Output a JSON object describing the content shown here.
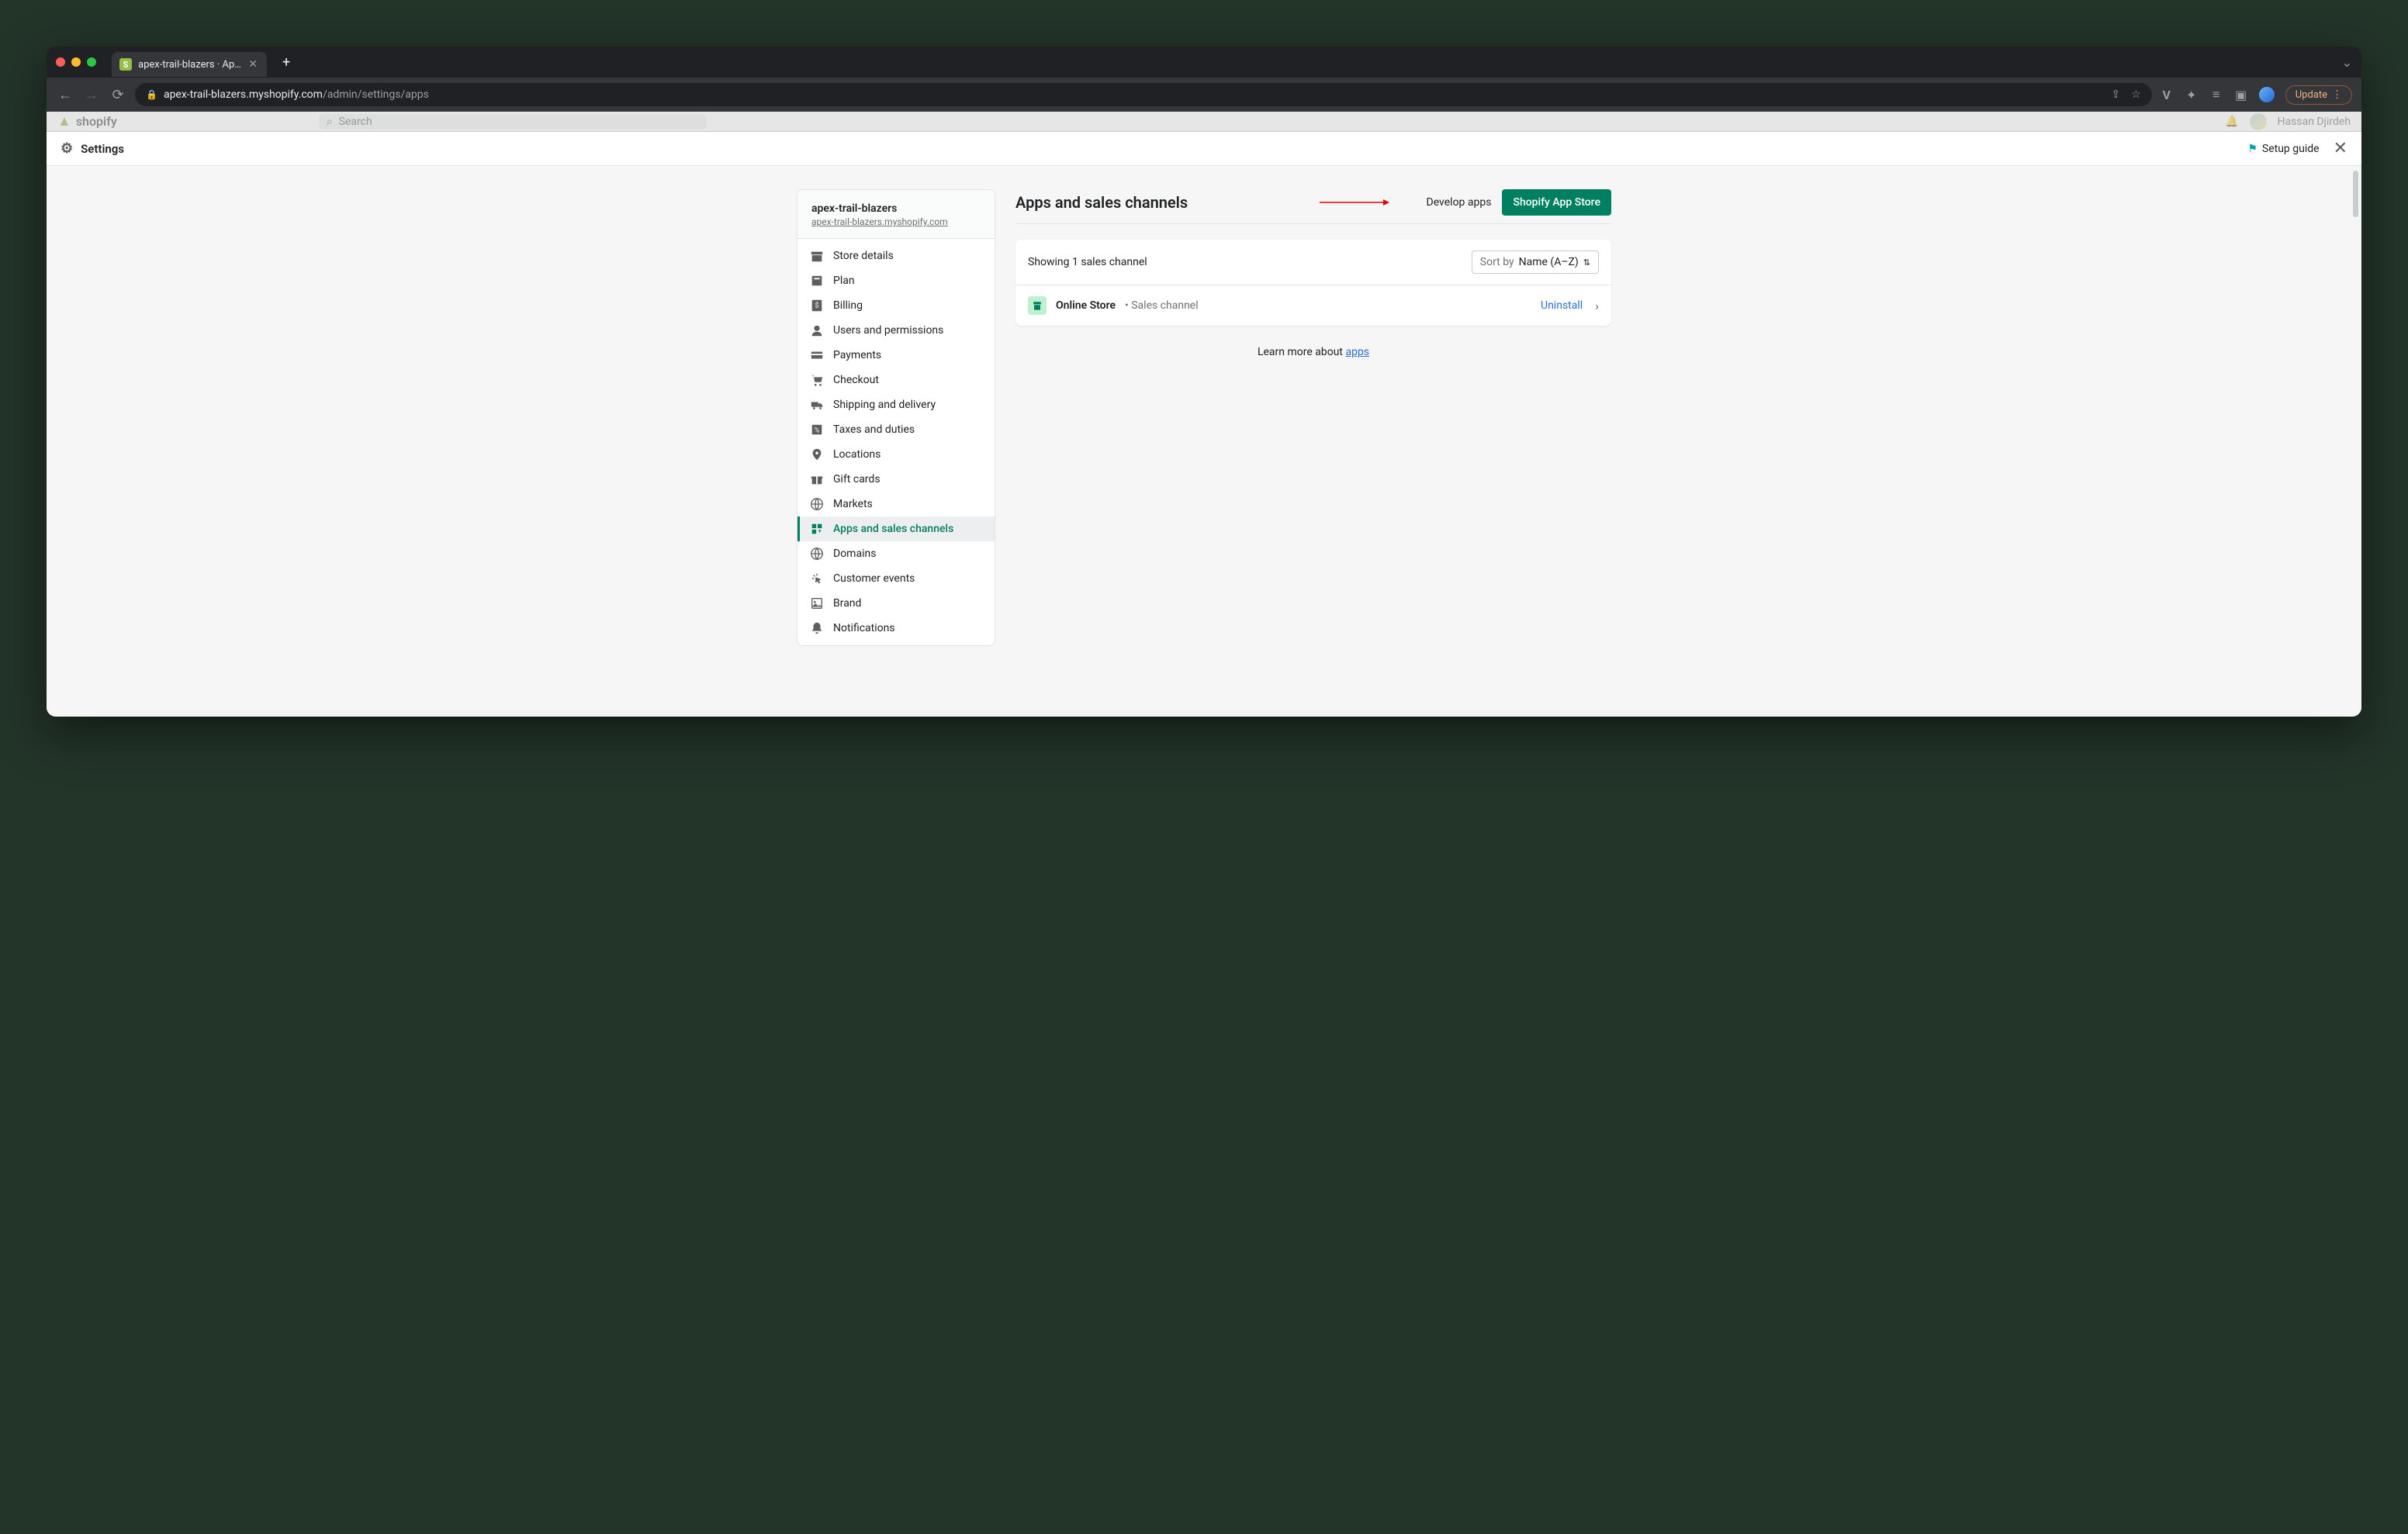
{
  "browser": {
    "tab_title": "apex-trail-blazers · Apps and s",
    "url_host": "apex-trail-blazers.myshopify.com",
    "url_path": "/admin/settings/apps",
    "update_label": "Update"
  },
  "admin_bg": {
    "brand": "shopify",
    "search_placeholder": "Search",
    "user_name": "Hassan Djirdeh"
  },
  "overlay": {
    "title": "Settings",
    "setup_guide": "Setup guide"
  },
  "sidebar": {
    "store": "apex-trail-blazers",
    "domain": "apex-trail-blazers.myshopify.com",
    "items": [
      {
        "label": "Store details"
      },
      {
        "label": "Plan"
      },
      {
        "label": "Billing"
      },
      {
        "label": "Users and permissions"
      },
      {
        "label": "Payments"
      },
      {
        "label": "Checkout"
      },
      {
        "label": "Shipping and delivery"
      },
      {
        "label": "Taxes and duties"
      },
      {
        "label": "Locations"
      },
      {
        "label": "Gift cards"
      },
      {
        "label": "Markets"
      },
      {
        "label": "Apps and sales channels"
      },
      {
        "label": "Domains"
      },
      {
        "label": "Customer events"
      },
      {
        "label": "Brand"
      },
      {
        "label": "Notifications"
      }
    ]
  },
  "main": {
    "title": "Apps and sales channels",
    "develop": "Develop apps",
    "appstore": "Shopify App Store",
    "showing": "Showing 1 sales channel",
    "sort_label": "Sort by",
    "sort_value": "Name (A–Z)",
    "row": {
      "name": "Online Store",
      "type": "Sales channel",
      "uninstall": "Uninstall"
    },
    "learn_prefix": "Learn more about ",
    "learn_link": "apps"
  }
}
